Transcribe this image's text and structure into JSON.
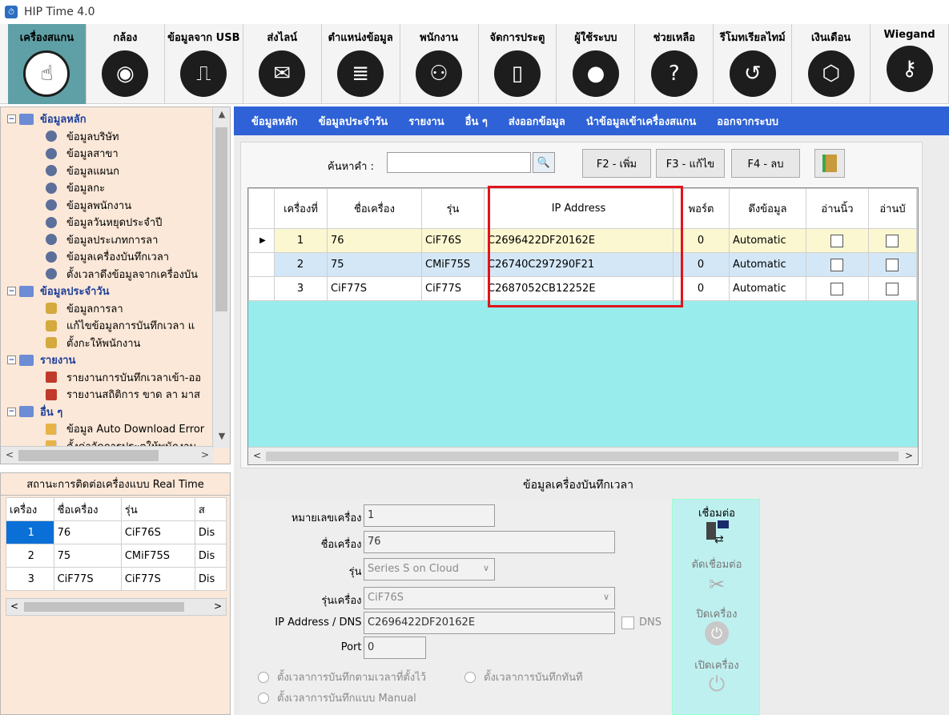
{
  "window": {
    "title": "HIP Time 4.0"
  },
  "toolbar": [
    {
      "label": "เครื่องสแกน",
      "icon": "hand-pointer-icon",
      "glyph": "☝"
    },
    {
      "label": "กล้อง",
      "icon": "cctv-camera-icon",
      "glyph": "◉"
    },
    {
      "label": "ข้อมูลจาก USB",
      "icon": "usb-icon",
      "glyph": "⎍"
    },
    {
      "label": "ส่งไลน์",
      "icon": "line-message-icon",
      "glyph": "✉"
    },
    {
      "label": "ตำแหน่งข้อมูล",
      "icon": "database-icon",
      "glyph": "≣"
    },
    {
      "label": "พนักงาน",
      "icon": "employees-icon",
      "glyph": "⚇"
    },
    {
      "label": "จัดการประตู",
      "icon": "door-icon",
      "glyph": "▯"
    },
    {
      "label": "ผู้ใช้ระบบ",
      "icon": "user-icon",
      "glyph": "●"
    },
    {
      "label": "ช่วยเหลือ",
      "icon": "help-icon",
      "glyph": "?"
    },
    {
      "label": "รีโมทเรียลไทม์",
      "icon": "history-clock-icon",
      "glyph": "↺"
    },
    {
      "label": "เงินเดือน",
      "icon": "payroll-icon",
      "glyph": "⬡"
    },
    {
      "label": "Wiegand",
      "icon": "key-icon",
      "glyph": "⚷"
    }
  ],
  "tree": {
    "groups": [
      {
        "label": "ข้อมูลหลัก",
        "children": [
          "ข้อมูลบริษัท",
          "ข้อมูลสาขา",
          "ข้อมูลแผนก",
          "ข้อมูลกะ",
          "ข้อมูลพนักงาน",
          "ข้อมูลวันหยุดประจำปี",
          "ข้อมูลประเภทการลา",
          "ข้อมูลเครื่องบันทึกเวลา",
          "ตั้งเวลาดึงข้อมูลจากเครื่องบัน"
        ]
      },
      {
        "label": "ข้อมูลประจำวัน",
        "children": [
          "ข้อมูลการลา",
          "แก้ไขข้อมูลการบันทึกเวลา แ",
          "ตั้งกะให้พนักงาน"
        ]
      },
      {
        "label": "รายงาน",
        "children": [
          "รายงานการบันทึกเวลาเข้า-ออ",
          "รายงานสถิติการ ขาด ลา มาส"
        ]
      },
      {
        "label": "อื่น ๆ",
        "children": [
          "ข้อมูล Auto Download Error",
          "ตั้งค่าจัดการประตูให้พนักงาน"
        ]
      }
    ]
  },
  "realtime": {
    "title": "สถานะการติดต่อเครื่องแบบ Real Time",
    "columns": [
      "เครื่อง",
      "ชื่อเครื่อง",
      "รุ่น",
      "ส"
    ],
    "rows": [
      [
        "1",
        "76",
        "CiF76S",
        "Dis"
      ],
      [
        "2",
        "75",
        "CMiF75S",
        "Dis"
      ],
      [
        "3",
        "CiF77S",
        "CiF77S",
        "Dis"
      ]
    ]
  },
  "menubar": [
    "ข้อมูลหลัก",
    "ข้อมูลประจำวัน",
    "รายงาน",
    "อื่น ๆ",
    "ส่งออกข้อมูล",
    "นำข้อมูลเข้าเครื่องสแกน",
    "ออกจากระบบ"
  ],
  "search": {
    "label": "ค้นหาคำ :",
    "value": "",
    "add": "F2 - เพิ่ม",
    "edit": "F3 - แก้ไข",
    "delete": "F4 - ลบ"
  },
  "grid": {
    "columns": [
      "เครื่องที่",
      "ชื่อเครื่อง",
      "รุ่น",
      "IP Address",
      "พอร์ต",
      "ดึงข้อมูล",
      "อ่านนิ้ว",
      "อ่านบั"
    ],
    "rows": [
      {
        "no": "1",
        "name": "76",
        "model": "CiF76S",
        "ip": "C2696422DF20162E",
        "port": "0",
        "fetch": "Automatic",
        "finger": false,
        "card": false
      },
      {
        "no": "2",
        "name": "75",
        "model": "CMiF75S",
        "ip": "C26740C297290F21",
        "port": "0",
        "fetch": "Automatic",
        "finger": false,
        "card": false
      },
      {
        "no": "3",
        "name": "CiF77S",
        "model": "CiF77S",
        "ip": "C2687052CB12252E",
        "port": "0",
        "fetch": "Automatic",
        "finger": false,
        "card": false
      }
    ]
  },
  "detail": {
    "title": "ข้อมูลเครื่องบันทึกเวลา",
    "machine_no_label": "หมายเลขเครื่อง :",
    "machine_no": "1",
    "machine_name_label": "ชื่อเครื่อง :",
    "machine_name": "76",
    "series_label": "รุ่น :",
    "series": "Series S on Cloud",
    "model_label": "รุ่นเครื่อง :",
    "model": "CiF76S",
    "ip_label": "IP Address / DNS :",
    "ip": "C2696422DF20162E",
    "dns_label": "DNS",
    "port_label": "Port :",
    "port": "0",
    "radio1": "ตั้งเวลาการบันทึกตามเวลาที่ตั้งไว้",
    "radio2": "ตั้งเวลาการบันทึกทันที",
    "radio3": "ตั้งเวลาการบันทึกแบบ Manual"
  },
  "connect": {
    "connect": "เชื่อมต่อ",
    "disconnect": "ตัดเชื่อมต่อ",
    "power_off": "ปิดเครื่อง",
    "power_on": "เปิดเครื่อง"
  }
}
